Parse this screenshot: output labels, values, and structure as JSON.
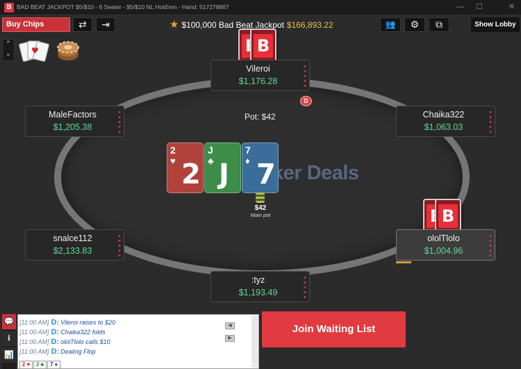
{
  "titlebar": {
    "logo": "B",
    "title": "BAD BEAT JACKPOT $5/$10 - 6 Seater - $5/$10 NL Hold'em - Hand: 517278867",
    "minimize": "—",
    "maximize": "☐",
    "close": "✕"
  },
  "toolbar": {
    "buy_chips": "Buy Chips",
    "swap_icon": "⇄",
    "exit_icon": "⇥",
    "jackpot_star": "★",
    "jackpot_label": "$100,000 Bad Beat Jackpot",
    "jackpot_amount": "$166,893.22",
    "players_icon": "👥",
    "settings_icon": "⚙",
    "layout_icon": "⧉",
    "show_lobby": "Show Lobby"
  },
  "side": {
    "arrows": "⌃\n⌄"
  },
  "table": {
    "pot_label": "Pot: $42",
    "dealer": "D",
    "watermark": "Poker Deals",
    "main_pot_amount": "$42",
    "main_pot_label": "Main pot",
    "hole_card_logo": "B"
  },
  "seats": [
    {
      "name": "Vileroi",
      "stack": "$1,176.28"
    },
    {
      "name": "MaleFactors",
      "stack": "$1,205.38"
    },
    {
      "name": "Chaika322",
      "stack": "$1,063.03"
    },
    {
      "name": "snalce112",
      "stack": "$2,133.83"
    },
    {
      "name": "ololTlolo",
      "stack": "$1,004.96"
    },
    {
      "name": ":tyz",
      "stack": "$1,193.49"
    }
  ],
  "board": [
    {
      "rank": "2",
      "suit": "♥",
      "color": "#b0413b"
    },
    {
      "rank": "J",
      "suit": "♣",
      "color": "#3c8d48"
    },
    {
      "rank": "7",
      "suit": "♦",
      "color": "#3a6d9a"
    }
  ],
  "chat": {
    "lines": [
      {
        "time": "[11:00 AM]",
        "dealer": "D:",
        "text": "Vileroi  raises to $20"
      },
      {
        "time": "[11:00 AM]",
        "dealer": "D:",
        "text": "Chaika322  folds"
      },
      {
        "time": "[11:00 AM]",
        "dealer": "D:",
        "text": "ololTlolo  calls $10"
      },
      {
        "time": "[11:00 AM]",
        "dealer": "D:",
        "text": "Dealing Flop"
      }
    ],
    "mini_cards": [
      {
        "label": "2 ♥",
        "color": "#d22"
      },
      {
        "label": "J ♣",
        "color": "#282"
      },
      {
        "label": "7 ♦",
        "color": "#22c"
      }
    ],
    "arrow_left": "◀",
    "arrow_right": "▶",
    "tabs": [
      "💬",
      "ℹ",
      "📊"
    ]
  },
  "join_waiting_list": "Join Waiting List"
}
